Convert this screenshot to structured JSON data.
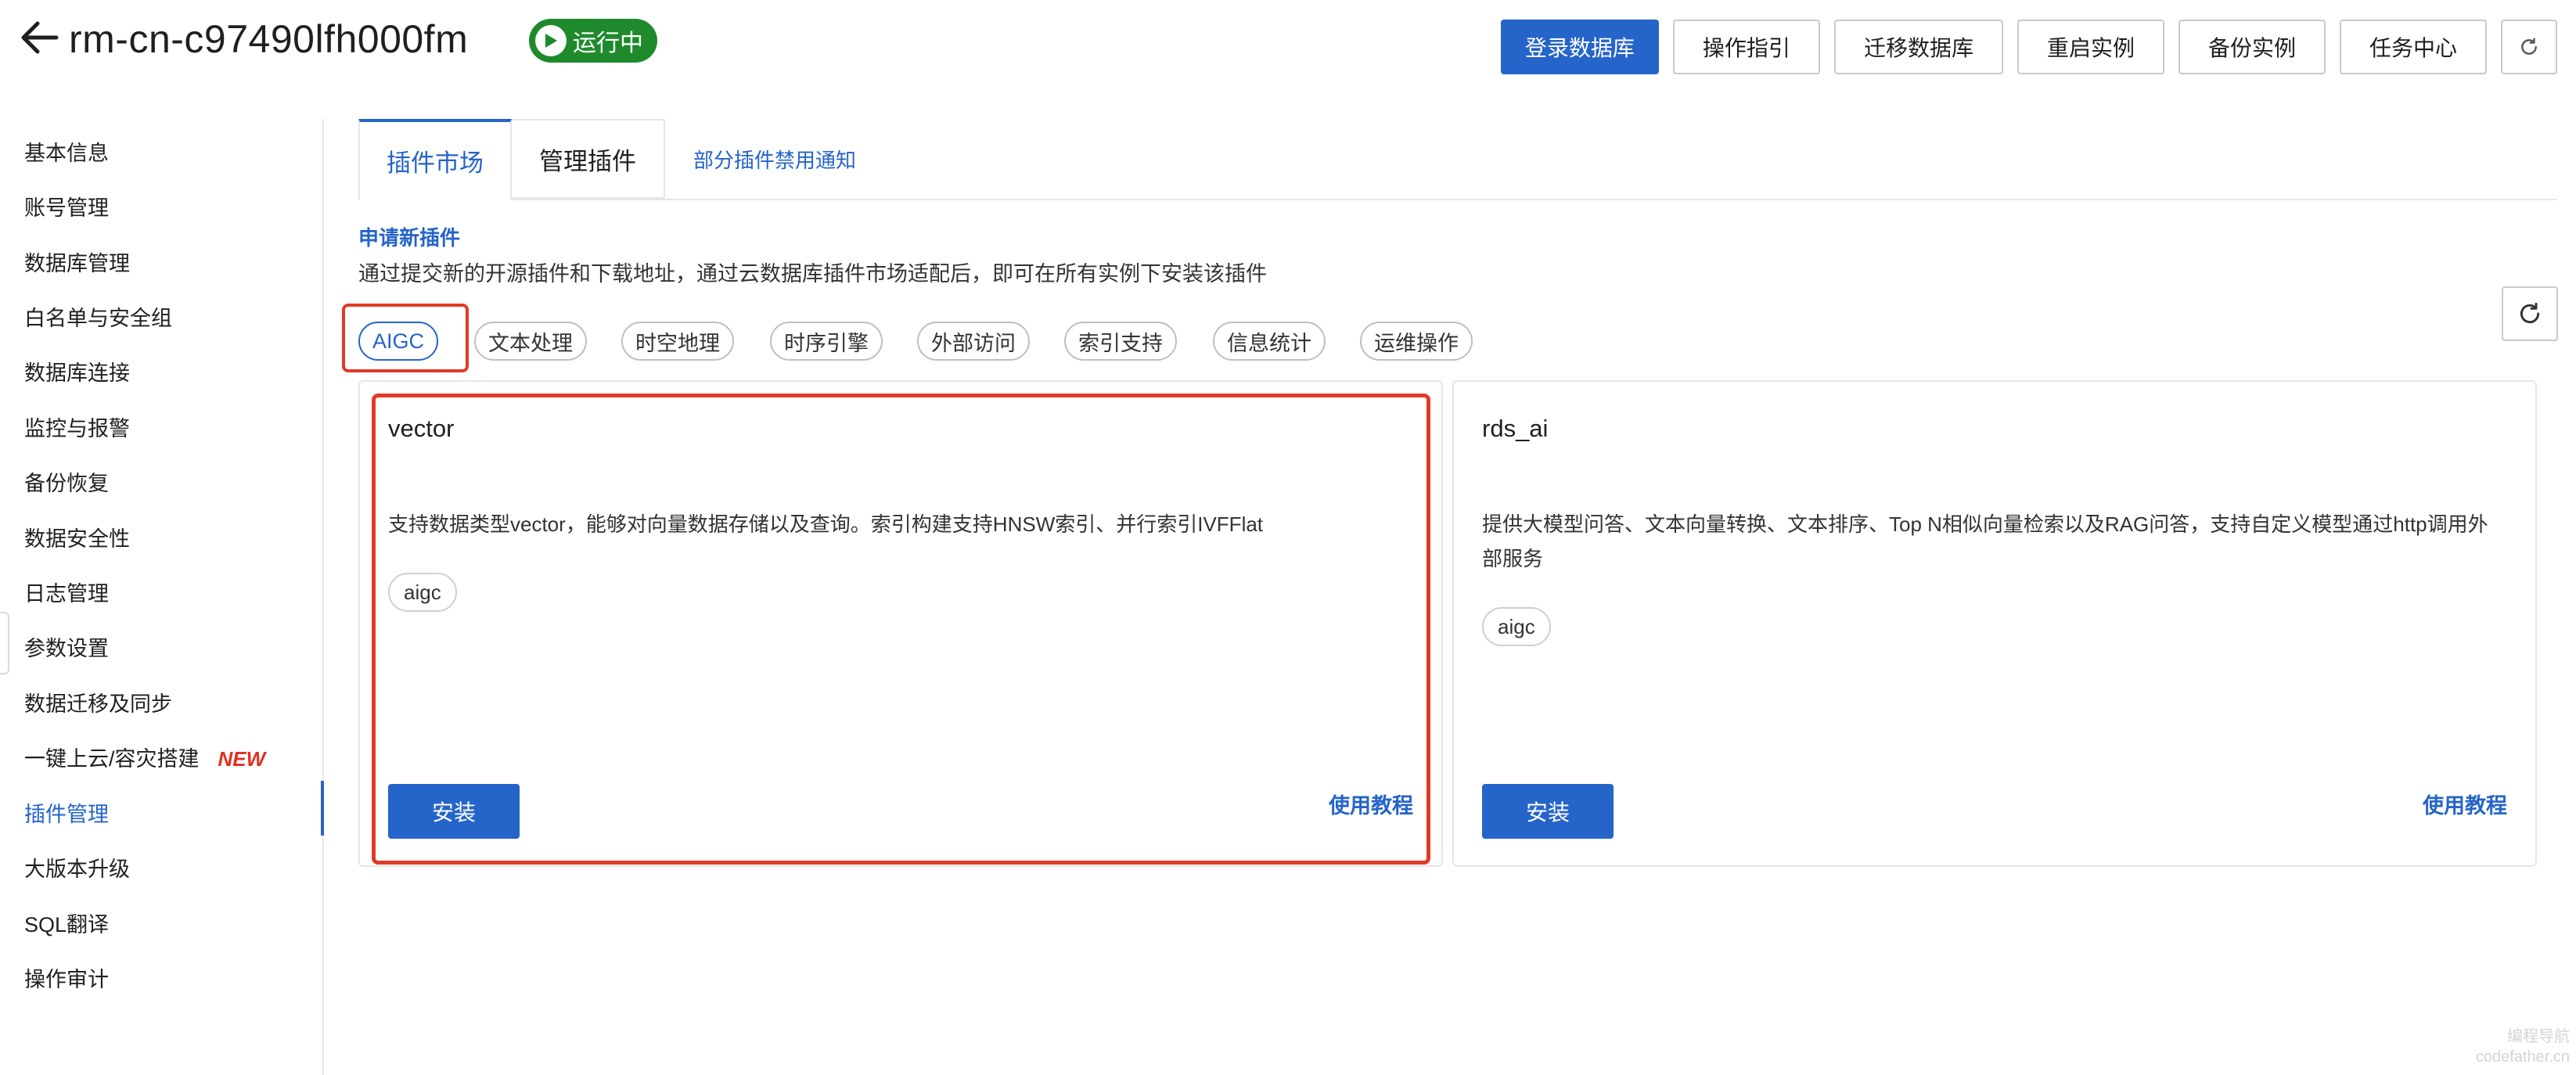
{
  "header": {
    "title": "rm-cn-c97490lfh000fm",
    "status": "运行中",
    "buttons": {
      "login": "登录数据库",
      "guide": "操作指引",
      "migrate": "迁移数据库",
      "restart": "重启实例",
      "backup": "备份实例",
      "tasks": "任务中心"
    }
  },
  "sidebar": {
    "items": [
      {
        "label": "基本信息"
      },
      {
        "label": "账号管理"
      },
      {
        "label": "数据库管理"
      },
      {
        "label": "白名单与安全组"
      },
      {
        "label": "数据库连接"
      },
      {
        "label": "监控与报警"
      },
      {
        "label": "备份恢复"
      },
      {
        "label": "数据安全性"
      },
      {
        "label": "日志管理"
      },
      {
        "label": "参数设置"
      },
      {
        "label": "数据迁移及同步"
      },
      {
        "label": "一键上云/容灾搭建",
        "tag": "NEW"
      },
      {
        "label": "插件管理"
      },
      {
        "label": "大版本升级"
      },
      {
        "label": "SQL翻译"
      },
      {
        "label": "操作审计"
      }
    ]
  },
  "tabs": {
    "market": "插件市场",
    "manage": "管理插件",
    "notice": "部分插件禁用通知"
  },
  "apply": {
    "title": "申请新插件",
    "desc": "通过提交新的开源插件和下载地址，通过云数据库插件市场适配后，即可在所有实例下安装该插件"
  },
  "filters": [
    "AIGC",
    "文本处理",
    "时空地理",
    "时序引擎",
    "外部访问",
    "索引支持",
    "信息统计",
    "运维操作"
  ],
  "cards": [
    {
      "name": "vector",
      "desc": "支持数据类型vector，能够对向量数据存储以及查询。索引构建支持HNSW索引、并行索引IVFFlat",
      "tag": "aigc",
      "install": "安装",
      "tutorial": "使用教程"
    },
    {
      "name": "rds_ai",
      "desc": "提供大模型问答、文本向量转换、文本排序、Top N相似向量检索以及RAG问答，支持自定义模型通过http调用外部服务",
      "tag": "aigc",
      "install": "安装",
      "tutorial": "使用教程"
    }
  ],
  "watermark": [
    "编程导航",
    "codefather.cn"
  ],
  "colors": {
    "accent": "#2564c9",
    "status": "#1f8a2c",
    "highlight": "#e03a27",
    "new_tag": "#e0301e"
  }
}
